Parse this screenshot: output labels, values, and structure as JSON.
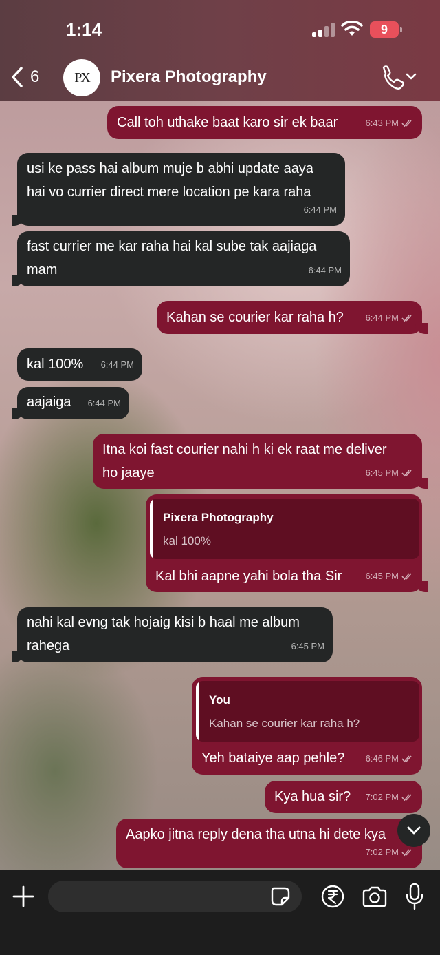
{
  "status_bar": {
    "time": "1:14",
    "battery": "9"
  },
  "header": {
    "back_count": "6",
    "contact_name": "Pixera Photography",
    "avatar_text": "PX"
  },
  "messages": [
    {
      "dir": "out",
      "text": "Call toh uthake baat karo sir ek baar",
      "time": "6:43 PM"
    },
    {
      "dir": "in",
      "text": "usi ke pass hai album muje b abhi update aaya\nhai vo currier direct mere location pe kara raha",
      "time": "6:44 PM"
    },
    {
      "dir": "in",
      "text": "fast currier me kar raha hai kal sube tak aajiaga\nmam",
      "time": "6:44 PM"
    },
    {
      "dir": "out",
      "text": "Kahan se courier kar raha h?",
      "time": "6:44 PM"
    },
    {
      "dir": "in",
      "text": "kal 100%",
      "time": "6:44 PM"
    },
    {
      "dir": "in",
      "text": "aajaiga",
      "time": "6:44 PM"
    },
    {
      "dir": "out",
      "text": "Itna koi fast courier nahi h ki ek raat me deliver\nho jaaye",
      "time": "6:45 PM"
    },
    {
      "dir": "out",
      "text": "Kal bhi aapne yahi bola tha Sir",
      "time": "6:45 PM",
      "quote": {
        "author": "Pixera Photography",
        "text": "kal 100%"
      }
    },
    {
      "dir": "in",
      "text": "nahi kal evng tak hojaig kisi b haal me album\nrahega",
      "time": "6:45 PM"
    },
    {
      "dir": "out",
      "text": "Yeh bataiye aap pehle?",
      "time": "6:46 PM",
      "quote": {
        "author": "You",
        "text": "Kahan se courier kar raha h?"
      }
    },
    {
      "dir": "out",
      "text": "Kya hua sir?",
      "time": "7:02 PM"
    },
    {
      "dir": "out",
      "text": "Aapko jitna reply dena tha utna hi dete kya",
      "time": "7:02 PM"
    }
  ],
  "input": {
    "placeholder": ""
  }
}
